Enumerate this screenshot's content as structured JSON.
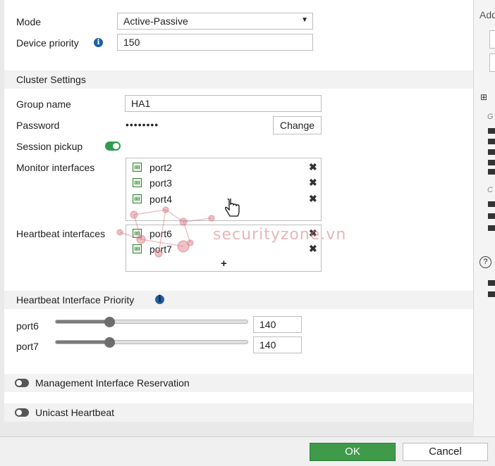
{
  "form": {
    "mode_label": "Mode",
    "mode_value": "Active-Passive",
    "device_priority_label": "Device priority",
    "device_priority_value": "150"
  },
  "cluster": {
    "section_title": "Cluster Settings",
    "group_name_label": "Group name",
    "group_name_value": "HA1",
    "password_label": "Password",
    "password_value": "••••••••",
    "change_button": "Change",
    "session_pickup_label": "Session pickup",
    "session_pickup_enabled": true,
    "monitor_label": "Monitor interfaces",
    "monitor_interfaces": [
      "port2",
      "port3",
      "port4"
    ],
    "heartbeat_label": "Heartbeat interfaces",
    "heartbeat_interfaces": [
      "port6",
      "port7"
    ],
    "add_symbol": "+"
  },
  "priority": {
    "section_title": "Heartbeat Interface Priority",
    "rows": [
      {
        "label": "port6",
        "value": "140",
        "slider_fraction": 0.28
      },
      {
        "label": "port7",
        "value": "140",
        "slider_fraction": 0.28
      }
    ]
  },
  "toggles": {
    "mgmt_reservation": "Management Interface Reservation",
    "unicast_heartbeat": "Unicast Heartbeat"
  },
  "right_panel": {
    "title_fragment": "Add",
    "label_g": "G",
    "label_c": "C",
    "help_symbol": "?"
  },
  "watermark": "securityzone.vn",
  "footer": {
    "ok_label": "OK",
    "cancel_label": "Cancel"
  },
  "colors": {
    "ok_button": "#3f9a4a",
    "toggle_on": "#2f9d4d",
    "info_icon": "#1f5fa8"
  }
}
